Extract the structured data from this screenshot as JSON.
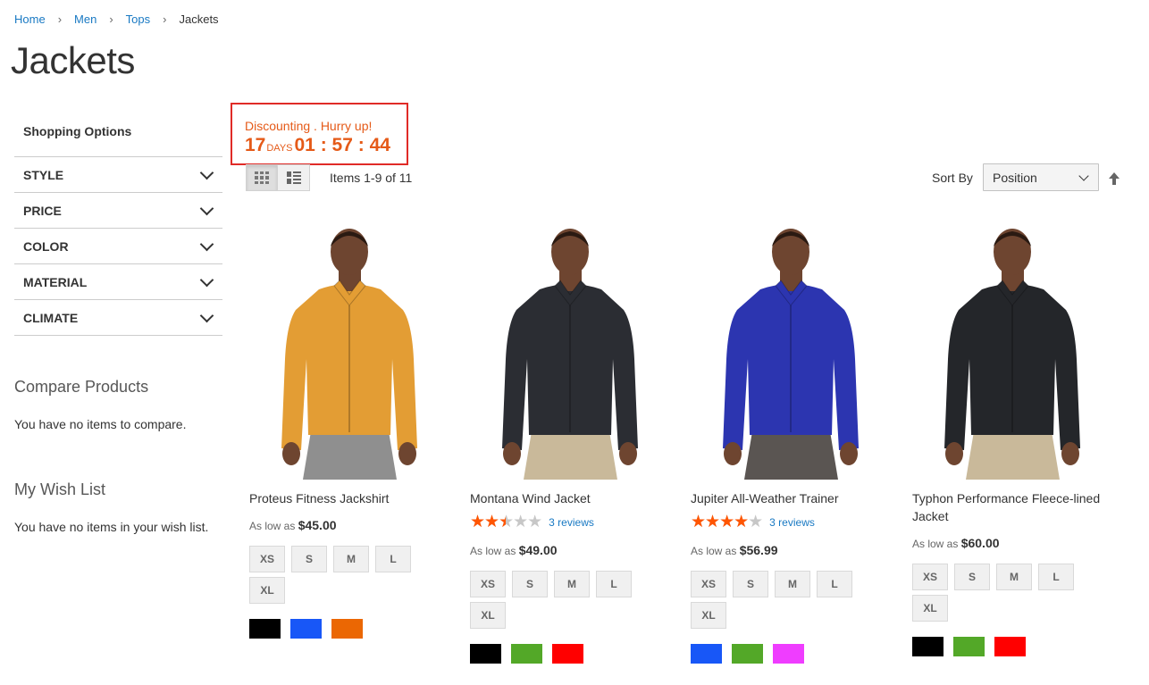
{
  "breadcrumb": [
    "Home",
    "Men",
    "Tops",
    "Jackets"
  ],
  "page_title": "Jackets",
  "sidebar": {
    "shopping_options": "Shopping Options",
    "filters": [
      "STYLE",
      "PRICE",
      "COLOR",
      "MATERIAL",
      "CLIMATE"
    ],
    "compare": {
      "title": "Compare Products",
      "text": "You have no items to compare."
    },
    "wishlist": {
      "title": "My Wish List",
      "text": "You have no items in your wish list."
    }
  },
  "countdown": {
    "message": "Discounting . Hurry up!",
    "days": "17",
    "days_label": "DAYS",
    "hours": "01",
    "minutes": "57",
    "seconds": "44"
  },
  "toolbar": {
    "amount": "Items 1-9 of 11",
    "sort_label": "Sort By",
    "sort_value": "Position"
  },
  "products": [
    {
      "name": "Proteus Fitness Jackshirt",
      "price_label": "As low as",
      "price": "$45.00",
      "rating": null,
      "reviews": null,
      "sizes": [
        "XS",
        "S",
        "M",
        "L",
        "XL"
      ],
      "colors": [
        "#000000",
        "#1857f7",
        "#eb6703"
      ],
      "jacket_color": "#e39d34",
      "pants_color": "#8f8f8f",
      "skin_color": "#6e4530"
    },
    {
      "name": "Montana Wind Jacket",
      "price_label": "As low as",
      "price": "$49.00",
      "rating": 0.5,
      "reviews": "3 reviews",
      "sizes": [
        "XS",
        "S",
        "M",
        "L",
        "XL"
      ],
      "colors": [
        "#000000",
        "#53a828",
        "#ff0000"
      ],
      "jacket_color": "#2b2d33",
      "pants_color": "#c9b99a",
      "skin_color": "#6e4530"
    },
    {
      "name": "Jupiter All-Weather Trainer",
      "price_label": "As low as",
      "price": "$56.99",
      "rating": 0.8,
      "reviews": "3 reviews",
      "sizes": [
        "XS",
        "S",
        "M",
        "L",
        "XL"
      ],
      "colors": [
        "#1857f7",
        "#53a828",
        "#ef3dff"
      ],
      "jacket_color": "#2c35b0",
      "pants_color": "#5a5552",
      "skin_color": "#6e4530"
    },
    {
      "name": "Typhon Performance Fleece-lined Jacket",
      "price_label": "As low as",
      "price": "$60.00",
      "rating": null,
      "reviews": null,
      "sizes": [
        "XS",
        "S",
        "M",
        "L",
        "XL"
      ],
      "colors": [
        "#000000",
        "#53a828",
        "#ff0000"
      ],
      "jacket_color": "#24262a",
      "pants_color": "#c9b99a",
      "skin_color": "#6e4530"
    }
  ],
  "colors": {
    "link": "#1979c3",
    "accent": "#e55a18",
    "countdown_border": "#e02b27",
    "star": "#ff5501"
  },
  "icons": [
    "chevron-down-icon",
    "grid-view-icon",
    "list-view-icon",
    "sort-arrow-up-icon",
    "star-icon"
  ]
}
